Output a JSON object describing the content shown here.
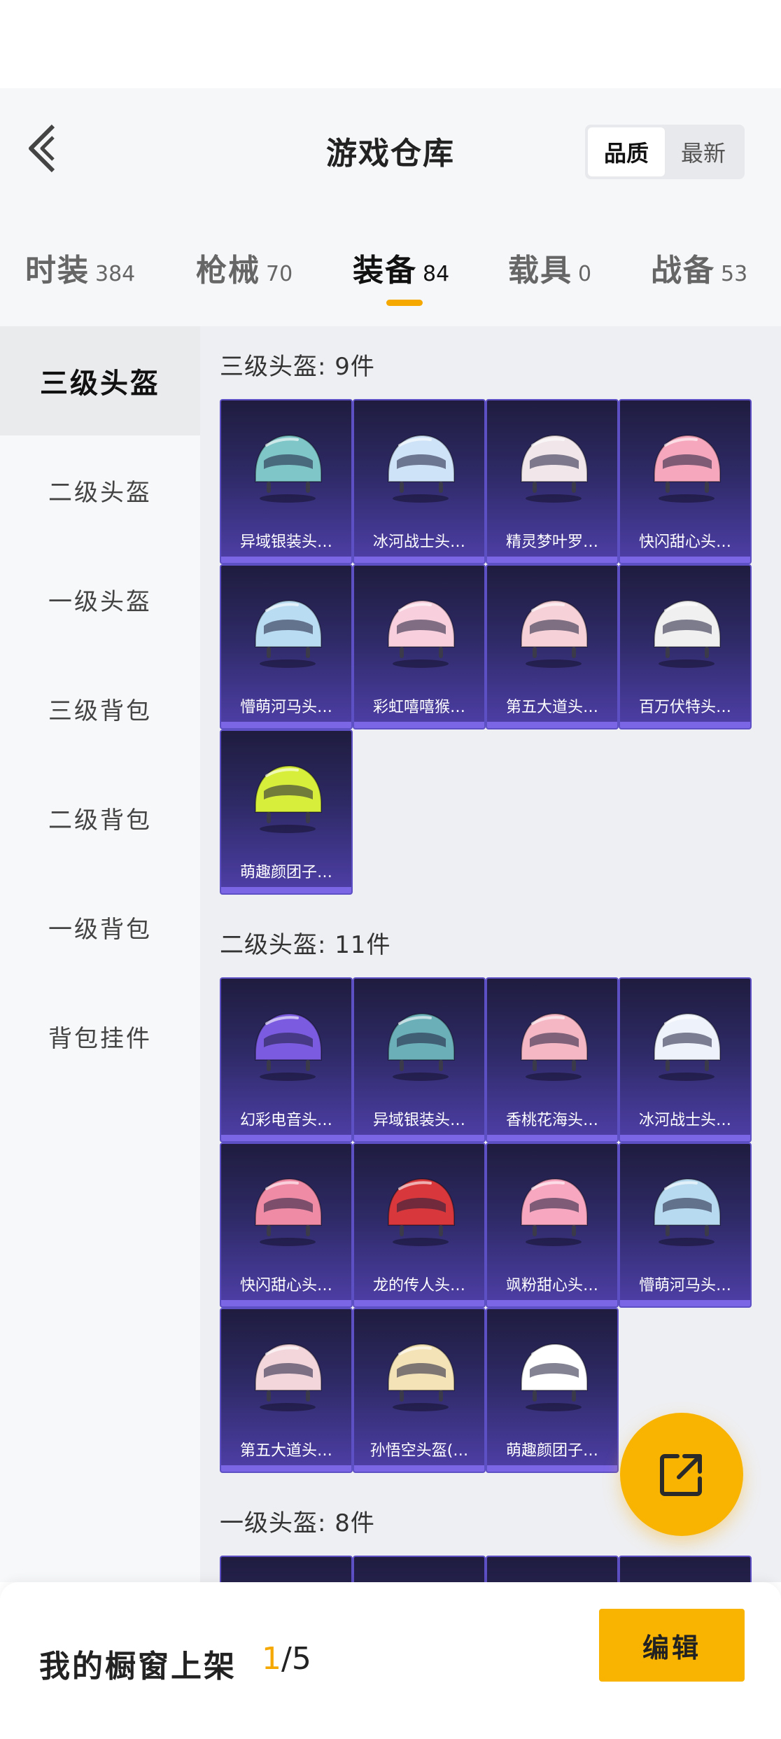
{
  "header": {
    "title": "游戏仓库",
    "sort_options": [
      "品质",
      "最新"
    ],
    "sort_selected": "品质"
  },
  "categories": [
    {
      "label": "时装",
      "count": "384",
      "active": false
    },
    {
      "label": "枪械",
      "count": "70",
      "active": false
    },
    {
      "label": "装备",
      "count": "84",
      "active": true
    },
    {
      "label": "载具",
      "count": "0",
      "active": false
    },
    {
      "label": "战备",
      "count": "53",
      "active": false
    }
  ],
  "sidebar": {
    "items": [
      "三级头盔",
      "二级头盔",
      "一级头盔",
      "三级背包",
      "二级背包",
      "一级背包",
      "背包挂件"
    ],
    "selected": "三级头盔"
  },
  "sections": [
    {
      "title": "三级头盔: 9件",
      "items": [
        {
          "name": "异域银装头…",
          "icon": "helmet-icon",
          "color": "#7fc6c9"
        },
        {
          "name": "冰河战士头…",
          "icon": "helmet-icon",
          "color": "#cfe3f8"
        },
        {
          "name": "精灵梦叶罗…",
          "icon": "helmet-icon",
          "color": "#f1e7ea"
        },
        {
          "name": "快闪甜心头…",
          "icon": "helmet-icon",
          "color": "#f7a7bd"
        },
        {
          "name": "懵萌河马头…",
          "icon": "helmet-icon",
          "color": "#b9dcf2"
        },
        {
          "name": "彩虹嘻嘻猴…",
          "icon": "helmet-icon",
          "color": "#f8cfdc"
        },
        {
          "name": "第五大道头…",
          "icon": "helmet-icon",
          "color": "#f6d2d8"
        },
        {
          "name": "百万伏特头…",
          "icon": "helmet-icon",
          "color": "#f0f0f0"
        },
        {
          "name": "萌趣颜团子…",
          "icon": "helmet-icon",
          "color": "#d7ef3a"
        }
      ]
    },
    {
      "title": "二级头盔: 11件",
      "items": [
        {
          "name": "幻彩电音头…",
          "icon": "helmet-icon",
          "color": "#7b5ce0"
        },
        {
          "name": "异域银装头…",
          "icon": "helmet-icon",
          "color": "#6bb0b8"
        },
        {
          "name": "香桃花海头…",
          "icon": "helmet-icon",
          "color": "#f6b7c5"
        },
        {
          "name": "冰河战士头…",
          "icon": "helmet-icon",
          "color": "#eef2fa"
        },
        {
          "name": "快闪甜心头…",
          "icon": "helmet-icon",
          "color": "#f08ba6"
        },
        {
          "name": "龙的传人头…",
          "icon": "helmet-icon",
          "color": "#d8383c"
        },
        {
          "name": "飒粉甜心头…",
          "icon": "helmet-icon",
          "color": "#f7a7c0"
        },
        {
          "name": "懵萌河马头…",
          "icon": "helmet-icon",
          "color": "#b7daf0"
        },
        {
          "name": "第五大道头…",
          "icon": "helmet-icon",
          "color": "#f3d6dc"
        },
        {
          "name": "孙悟空头盔(…",
          "icon": "helmet-icon",
          "color": "#f4e3b6"
        },
        {
          "name": "萌趣颜团子…",
          "icon": "helmet-icon",
          "color": "#ffffff"
        }
      ]
    },
    {
      "title": "一级头盔: 8件",
      "items": []
    }
  ],
  "bottom": {
    "showcase_label": "我的橱窗上架",
    "showcase_current": "1",
    "showcase_total": "/5",
    "edit_label": "编辑"
  }
}
